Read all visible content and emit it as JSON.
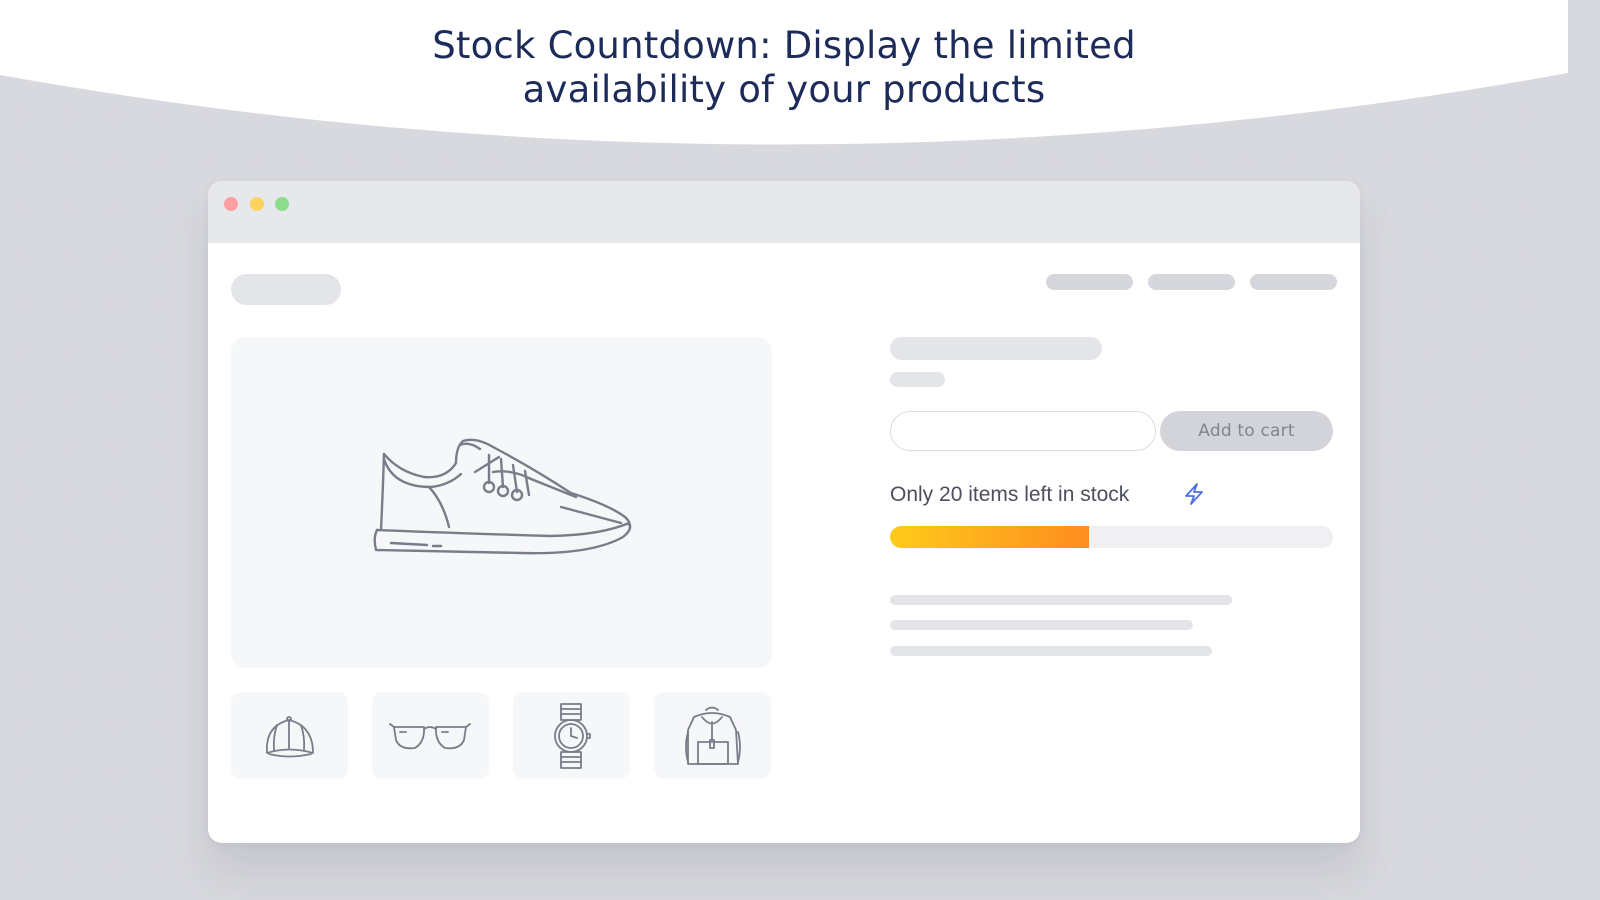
{
  "headline": {
    "line1": "Stock Countdown: Display the limited",
    "line2": "availability of your products"
  },
  "window": {
    "controls": [
      "close",
      "minimize",
      "maximize"
    ]
  },
  "product": {
    "main_image_icon": "sneaker-icon",
    "thumbnails": [
      "cap-icon",
      "sunglasses-icon",
      "watch-icon",
      "backpack-icon"
    ]
  },
  "purchase": {
    "add_to_cart_label": "Add to cart",
    "quantity_value": ""
  },
  "stock": {
    "message": "Only 20 items left in stock",
    "icon": "lightning-icon",
    "progress_fraction": 0.45
  },
  "colors": {
    "headline": "#1c2b5a",
    "progress_start": "#ffcb19",
    "progress_end": "#fe8d20",
    "bolt": "#4d6fe0"
  }
}
